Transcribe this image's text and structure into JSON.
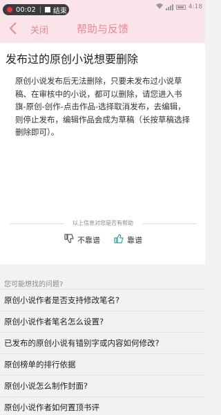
{
  "status": {
    "time_recording": "00:02",
    "end_label": "结束",
    "clock": "4:18"
  },
  "header": {
    "close_label": "关闭",
    "title": "帮助与反馈"
  },
  "article": {
    "title": "发布过的原创小说想要删除",
    "body": "原创小说发布后无法删除，只要未发布过小说草稿、在审核中的小说，都可以删除，请您进入书旗-原创-创作-点击作品-选择取消发布，去编辑，则停止发布，编辑作品会成为草稿（长按草稿选择删除即可）。",
    "helpful_prompt": "以上信息对您是否有帮助",
    "vote_no": "不靠谱",
    "vote_yes": "靠谱"
  },
  "related": {
    "heading": "您可能想找的问题?",
    "items": [
      "原创小说作者是否支持修改笔名?",
      "原创小说作者笔名怎么设置?",
      "已发布的原创小说有错别字或内容如何修改?",
      "原创榜单的排行依据",
      "原创小说怎么制作封面?",
      "原创小说作者如何置顶书评"
    ]
  },
  "colors": {
    "header_bg": "#fbe3ea",
    "accent": "#e7879b",
    "recording_dot": "#e53935",
    "vote_yes": "#2aa59a"
  }
}
